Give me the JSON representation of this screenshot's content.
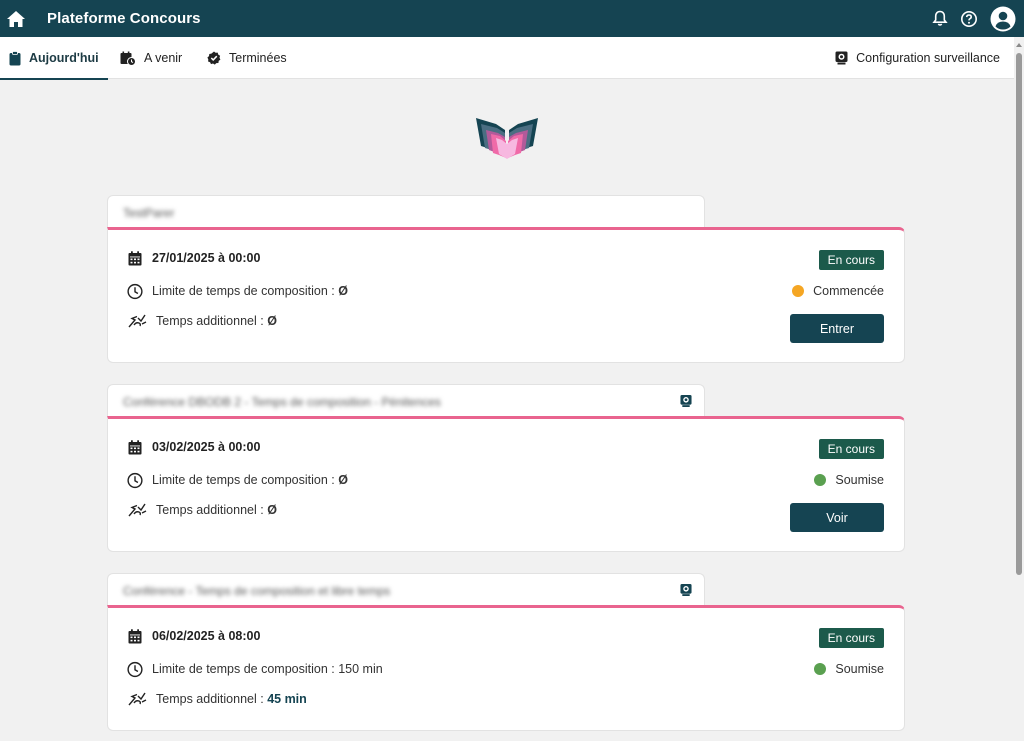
{
  "app": {
    "title": "Plateforme Concours"
  },
  "tabs": {
    "today": "Aujourd'hui",
    "upcoming": "A venir",
    "done": "Terminées",
    "config": "Configuration surveillance"
  },
  "colors": {
    "brand": "#154452",
    "accent_line": "#e9648f",
    "badge": "#1c5a4b",
    "started": "#f5a623",
    "submitted": "#5aa050"
  },
  "exams": [
    {
      "name": "TestParer",
      "date": "27/01/2025 à 00:00",
      "limit_label": "Limite de temps de composition :",
      "limit_value": "Ø",
      "extra_label": "Temps additionnel :",
      "extra_value": "Ø",
      "badge": "En cours",
      "status": "Commencée",
      "button": "Entrer"
    },
    {
      "name": "Conférence DBODB 2 - Temps de composition - Pénitences",
      "date": "03/02/2025 à 00:00",
      "limit_label": "Limite de temps de composition :",
      "limit_value": "Ø",
      "extra_label": "Temps additionnel :",
      "extra_value": "Ø",
      "badge": "En cours",
      "status": "Soumise",
      "button": "Voir"
    },
    {
      "name": "Conférence - Temps de composition et libre temps",
      "date": "06/02/2025 à 08:00",
      "limit_label": "Limite de temps de composition :",
      "limit_value": "150 min",
      "extra_label": "Temps additionnel :",
      "extra_value": "45 min",
      "badge": "En cours",
      "status": "Soumise"
    }
  ]
}
